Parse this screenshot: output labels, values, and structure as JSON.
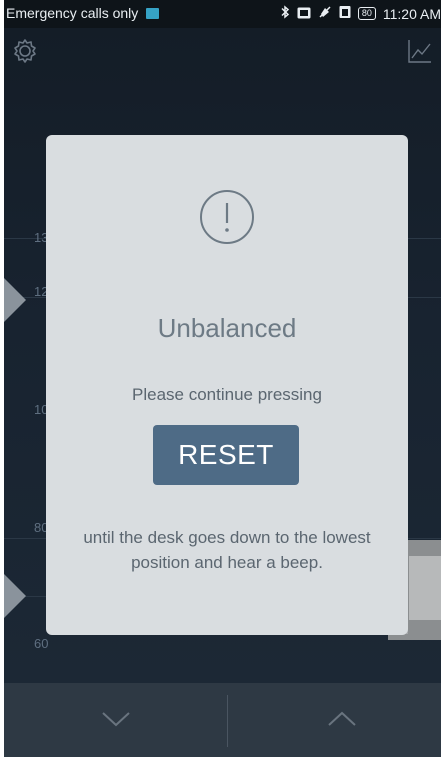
{
  "status_bar": {
    "carrier_text": "Emergency calls only",
    "battery_level": "80",
    "time": "11:20 AM",
    "icons": [
      "sim-icon",
      "bluetooth-icon",
      "nfc-icon",
      "mute-icon",
      "battery-saver-icon",
      "battery-icon"
    ]
  },
  "app": {
    "icons": [
      "gear-icon",
      "chart-icon"
    ],
    "scale_labels": [
      "13",
      "12",
      "10",
      "80",
      "60"
    ]
  },
  "dialog": {
    "icon": "alert-icon",
    "title": "Unbalanced",
    "message": "Please continue pressing",
    "button_label": "RESET",
    "instruction": "until the desk goes down to the lowest position and hear a beep."
  },
  "bottom_nav": {
    "icons": [
      "chevron-down-icon",
      "chevron-up-icon"
    ]
  },
  "colors": {
    "dialog_bg": "#d9dde0",
    "reset_button": "#4e6b86",
    "app_bg": "#1a2430"
  }
}
